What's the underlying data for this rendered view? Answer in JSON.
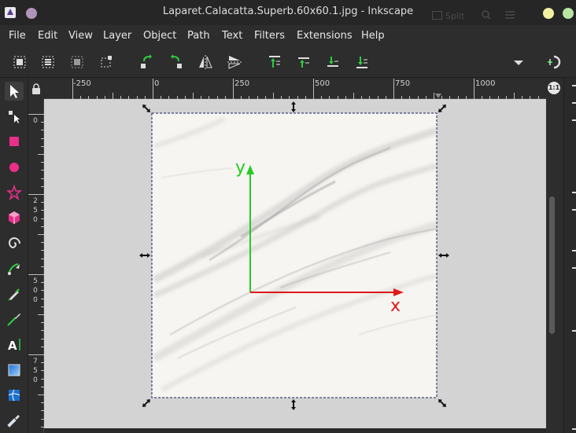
{
  "window": {
    "title": "Laparet.Calacatta.Superb.60x60.1.jpg - Inkscape",
    "split_label": "Split",
    "colors": {
      "close": "#f5f1a3",
      "maximize": "#b9e6a3",
      "menu_dot": "#b294bb"
    }
  },
  "menu": {
    "items": [
      "File",
      "Edit",
      "View",
      "Layer",
      "Object",
      "Path",
      "Text",
      "Filters",
      "Extensions",
      "Help"
    ]
  },
  "toolbar": {
    "icons": [
      "select-all-icon",
      "select-all-layers-icon",
      "deselect-icon",
      "selection-bounds-icon",
      "rotate-ccw-icon",
      "rotate-cw-icon",
      "flip-horizontal-icon",
      "flip-vertical-icon",
      "raise-to-top-icon",
      "raise-icon",
      "lower-icon",
      "lower-to-bottom-icon",
      "dropdown-arrow-icon",
      "snap-toggle-icon"
    ]
  },
  "rulers": {
    "horizontal_labels": [
      "-250",
      "0",
      "250",
      "500",
      "750",
      "1000"
    ],
    "vertical_labels": [
      [
        "0"
      ],
      [
        "2",
        "5",
        "0"
      ],
      [
        "5",
        "0",
        "0"
      ],
      [
        "7",
        "5",
        "0"
      ]
    ]
  },
  "tools": [
    "selector-tool-icon",
    "node-tool-icon",
    "rectangle-tool-icon",
    "ellipse-tool-icon",
    "star-tool-icon",
    "3d-box-tool-icon",
    "spiral-tool-icon",
    "pen-tool-icon",
    "pencil-tool-icon",
    "calligraphy-tool-icon",
    "text-tool-icon",
    "gradient-tool-icon",
    "mesh-tool-icon",
    "dropper-tool-icon"
  ],
  "canvas": {
    "axis_x_label": "x",
    "axis_y_label": "y",
    "colors": {
      "x_axis": "#e01818",
      "y_axis": "#22cc22",
      "selection_border": "#1a1a5a"
    }
  }
}
